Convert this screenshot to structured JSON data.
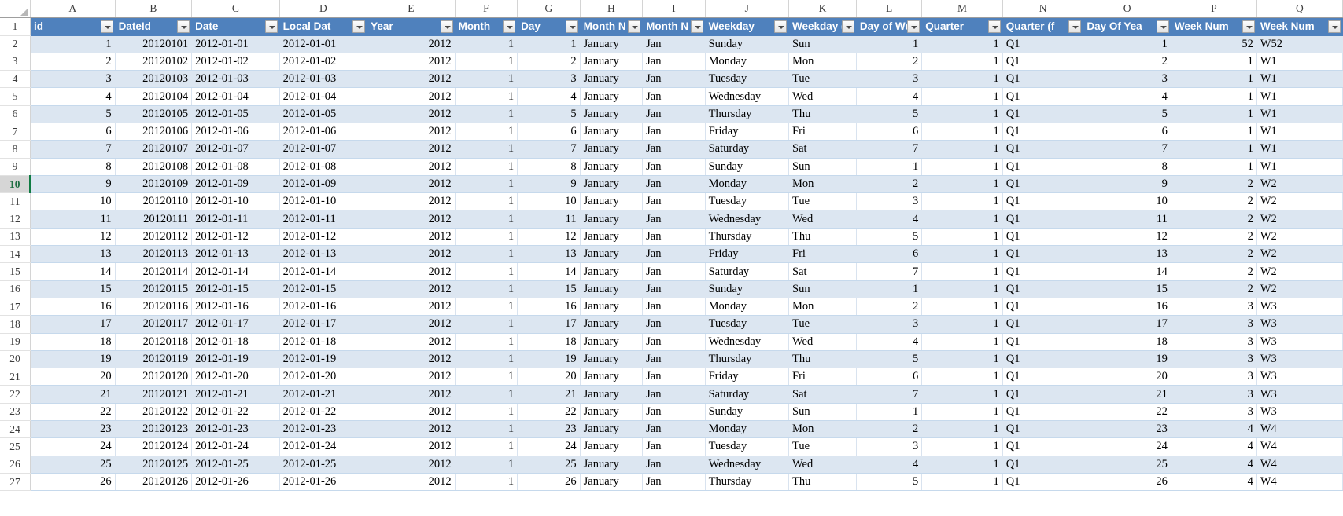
{
  "app": {
    "kind": "spreadsheet",
    "accent_header": "#4f81bd",
    "accent_band": "#dce6f1",
    "accent_active": "#0f7b42"
  },
  "grid": {
    "column_letters": [
      "A",
      "B",
      "C",
      "D",
      "E",
      "F",
      "G",
      "H",
      "I",
      "J",
      "K",
      "L",
      "M",
      "N",
      "O",
      "P",
      "Q"
    ],
    "row_numbers": [
      "1",
      "2",
      "3",
      "4",
      "5",
      "6",
      "7",
      "8",
      "9",
      "10",
      "11",
      "12",
      "13",
      "14",
      "15",
      "16",
      "17",
      "18",
      "19",
      "20",
      "21",
      "22",
      "23",
      "24",
      "25",
      "26",
      "27"
    ],
    "active_row": "10",
    "active_cell": "A10"
  },
  "table": {
    "headers": [
      {
        "letter": "A",
        "label": "id",
        "align": "num"
      },
      {
        "letter": "B",
        "label": "DateId",
        "align": "num"
      },
      {
        "letter": "C",
        "label": "Date",
        "align": "txt"
      },
      {
        "letter": "D",
        "label": "Local Dat",
        "align": "txt"
      },
      {
        "letter": "E",
        "label": "Year",
        "align": "num"
      },
      {
        "letter": "F",
        "label": "Month",
        "align": "num"
      },
      {
        "letter": "G",
        "label": "Day",
        "align": "num"
      },
      {
        "letter": "H",
        "label": "Month N",
        "align": "txt"
      },
      {
        "letter": "I",
        "label": "Month N",
        "align": "txt"
      },
      {
        "letter": "J",
        "label": "Weekday",
        "align": "txt"
      },
      {
        "letter": "K",
        "label": "Weekday (",
        "align": "txt"
      },
      {
        "letter": "L",
        "label": "Day of We",
        "align": "num"
      },
      {
        "letter": "M",
        "label": "Quarter",
        "align": "num"
      },
      {
        "letter": "N",
        "label": "Quarter (f",
        "align": "txt"
      },
      {
        "letter": "O",
        "label": "Day Of Yea",
        "align": "num"
      },
      {
        "letter": "P",
        "label": "Week Num",
        "align": "num"
      },
      {
        "letter": "Q",
        "label": "Week Num",
        "align": "txt"
      }
    ],
    "rows": [
      {
        "row": "2",
        "cells": [
          "1",
          "20120101",
          "2012-01-01",
          "2012-01-01",
          "2012",
          "1",
          "1",
          "January",
          "Jan",
          "Sunday",
          "Sun",
          "1",
          "1",
          "Q1",
          "1",
          "52",
          "W52"
        ]
      },
      {
        "row": "3",
        "cells": [
          "2",
          "20120102",
          "2012-01-02",
          "2012-01-02",
          "2012",
          "1",
          "2",
          "January",
          "Jan",
          "Monday",
          "Mon",
          "2",
          "1",
          "Q1",
          "2",
          "1",
          "W1"
        ]
      },
      {
        "row": "4",
        "cells": [
          "3",
          "20120103",
          "2012-01-03",
          "2012-01-03",
          "2012",
          "1",
          "3",
          "January",
          "Jan",
          "Tuesday",
          "Tue",
          "3",
          "1",
          "Q1",
          "3",
          "1",
          "W1"
        ]
      },
      {
        "row": "5",
        "cells": [
          "4",
          "20120104",
          "2012-01-04",
          "2012-01-04",
          "2012",
          "1",
          "4",
          "January",
          "Jan",
          "Wednesday",
          "Wed",
          "4",
          "1",
          "Q1",
          "4",
          "1",
          "W1"
        ]
      },
      {
        "row": "6",
        "cells": [
          "5",
          "20120105",
          "2012-01-05",
          "2012-01-05",
          "2012",
          "1",
          "5",
          "January",
          "Jan",
          "Thursday",
          "Thu",
          "5",
          "1",
          "Q1",
          "5",
          "1",
          "W1"
        ]
      },
      {
        "row": "7",
        "cells": [
          "6",
          "20120106",
          "2012-01-06",
          "2012-01-06",
          "2012",
          "1",
          "6",
          "January",
          "Jan",
          "Friday",
          "Fri",
          "6",
          "1",
          "Q1",
          "6",
          "1",
          "W1"
        ]
      },
      {
        "row": "8",
        "cells": [
          "7",
          "20120107",
          "2012-01-07",
          "2012-01-07",
          "2012",
          "1",
          "7",
          "January",
          "Jan",
          "Saturday",
          "Sat",
          "7",
          "1",
          "Q1",
          "7",
          "1",
          "W1"
        ]
      },
      {
        "row": "9",
        "cells": [
          "8",
          "20120108",
          "2012-01-08",
          "2012-01-08",
          "2012",
          "1",
          "8",
          "January",
          "Jan",
          "Sunday",
          "Sun",
          "1",
          "1",
          "Q1",
          "8",
          "1",
          "W1"
        ]
      },
      {
        "row": "10",
        "cells": [
          "9",
          "20120109",
          "2012-01-09",
          "2012-01-09",
          "2012",
          "1",
          "9",
          "January",
          "Jan",
          "Monday",
          "Mon",
          "2",
          "1",
          "Q1",
          "9",
          "2",
          "W2"
        ]
      },
      {
        "row": "11",
        "cells": [
          "10",
          "20120110",
          "2012-01-10",
          "2012-01-10",
          "2012",
          "1",
          "10",
          "January",
          "Jan",
          "Tuesday",
          "Tue",
          "3",
          "1",
          "Q1",
          "10",
          "2",
          "W2"
        ]
      },
      {
        "row": "12",
        "cells": [
          "11",
          "20120111",
          "2012-01-11",
          "2012-01-11",
          "2012",
          "1",
          "11",
          "January",
          "Jan",
          "Wednesday",
          "Wed",
          "4",
          "1",
          "Q1",
          "11",
          "2",
          "W2"
        ]
      },
      {
        "row": "13",
        "cells": [
          "12",
          "20120112",
          "2012-01-12",
          "2012-01-12",
          "2012",
          "1",
          "12",
          "January",
          "Jan",
          "Thursday",
          "Thu",
          "5",
          "1",
          "Q1",
          "12",
          "2",
          "W2"
        ]
      },
      {
        "row": "14",
        "cells": [
          "13",
          "20120113",
          "2012-01-13",
          "2012-01-13",
          "2012",
          "1",
          "13",
          "January",
          "Jan",
          "Friday",
          "Fri",
          "6",
          "1",
          "Q1",
          "13",
          "2",
          "W2"
        ]
      },
      {
        "row": "15",
        "cells": [
          "14",
          "20120114",
          "2012-01-14",
          "2012-01-14",
          "2012",
          "1",
          "14",
          "January",
          "Jan",
          "Saturday",
          "Sat",
          "7",
          "1",
          "Q1",
          "14",
          "2",
          "W2"
        ]
      },
      {
        "row": "16",
        "cells": [
          "15",
          "20120115",
          "2012-01-15",
          "2012-01-15",
          "2012",
          "1",
          "15",
          "January",
          "Jan",
          "Sunday",
          "Sun",
          "1",
          "1",
          "Q1",
          "15",
          "2",
          "W2"
        ]
      },
      {
        "row": "17",
        "cells": [
          "16",
          "20120116",
          "2012-01-16",
          "2012-01-16",
          "2012",
          "1",
          "16",
          "January",
          "Jan",
          "Monday",
          "Mon",
          "2",
          "1",
          "Q1",
          "16",
          "3",
          "W3"
        ]
      },
      {
        "row": "18",
        "cells": [
          "17",
          "20120117",
          "2012-01-17",
          "2012-01-17",
          "2012",
          "1",
          "17",
          "January",
          "Jan",
          "Tuesday",
          "Tue",
          "3",
          "1",
          "Q1",
          "17",
          "3",
          "W3"
        ]
      },
      {
        "row": "19",
        "cells": [
          "18",
          "20120118",
          "2012-01-18",
          "2012-01-18",
          "2012",
          "1",
          "18",
          "January",
          "Jan",
          "Wednesday",
          "Wed",
          "4",
          "1",
          "Q1",
          "18",
          "3",
          "W3"
        ]
      },
      {
        "row": "20",
        "cells": [
          "19",
          "20120119",
          "2012-01-19",
          "2012-01-19",
          "2012",
          "1",
          "19",
          "January",
          "Jan",
          "Thursday",
          "Thu",
          "5",
          "1",
          "Q1",
          "19",
          "3",
          "W3"
        ]
      },
      {
        "row": "21",
        "cells": [
          "20",
          "20120120",
          "2012-01-20",
          "2012-01-20",
          "2012",
          "1",
          "20",
          "January",
          "Jan",
          "Friday",
          "Fri",
          "6",
          "1",
          "Q1",
          "20",
          "3",
          "W3"
        ]
      },
      {
        "row": "22",
        "cells": [
          "21",
          "20120121",
          "2012-01-21",
          "2012-01-21",
          "2012",
          "1",
          "21",
          "January",
          "Jan",
          "Saturday",
          "Sat",
          "7",
          "1",
          "Q1",
          "21",
          "3",
          "W3"
        ]
      },
      {
        "row": "23",
        "cells": [
          "22",
          "20120122",
          "2012-01-22",
          "2012-01-22",
          "2012",
          "1",
          "22",
          "January",
          "Jan",
          "Sunday",
          "Sun",
          "1",
          "1",
          "Q1",
          "22",
          "3",
          "W3"
        ]
      },
      {
        "row": "24",
        "cells": [
          "23",
          "20120123",
          "2012-01-23",
          "2012-01-23",
          "2012",
          "1",
          "23",
          "January",
          "Jan",
          "Monday",
          "Mon",
          "2",
          "1",
          "Q1",
          "23",
          "4",
          "W4"
        ]
      },
      {
        "row": "25",
        "cells": [
          "24",
          "20120124",
          "2012-01-24",
          "2012-01-24",
          "2012",
          "1",
          "24",
          "January",
          "Jan",
          "Tuesday",
          "Tue",
          "3",
          "1",
          "Q1",
          "24",
          "4",
          "W4"
        ]
      },
      {
        "row": "26",
        "cells": [
          "25",
          "20120125",
          "2012-01-25",
          "2012-01-25",
          "2012",
          "1",
          "25",
          "January",
          "Jan",
          "Wednesday",
          "Wed",
          "4",
          "1",
          "Q1",
          "25",
          "4",
          "W4"
        ]
      },
      {
        "row": "27",
        "cells": [
          "26",
          "20120126",
          "2012-01-26",
          "2012-01-26",
          "2012",
          "1",
          "26",
          "January",
          "Jan",
          "Thursday",
          "Thu",
          "5",
          "1",
          "Q1",
          "26",
          "4",
          "W4"
        ]
      }
    ]
  }
}
